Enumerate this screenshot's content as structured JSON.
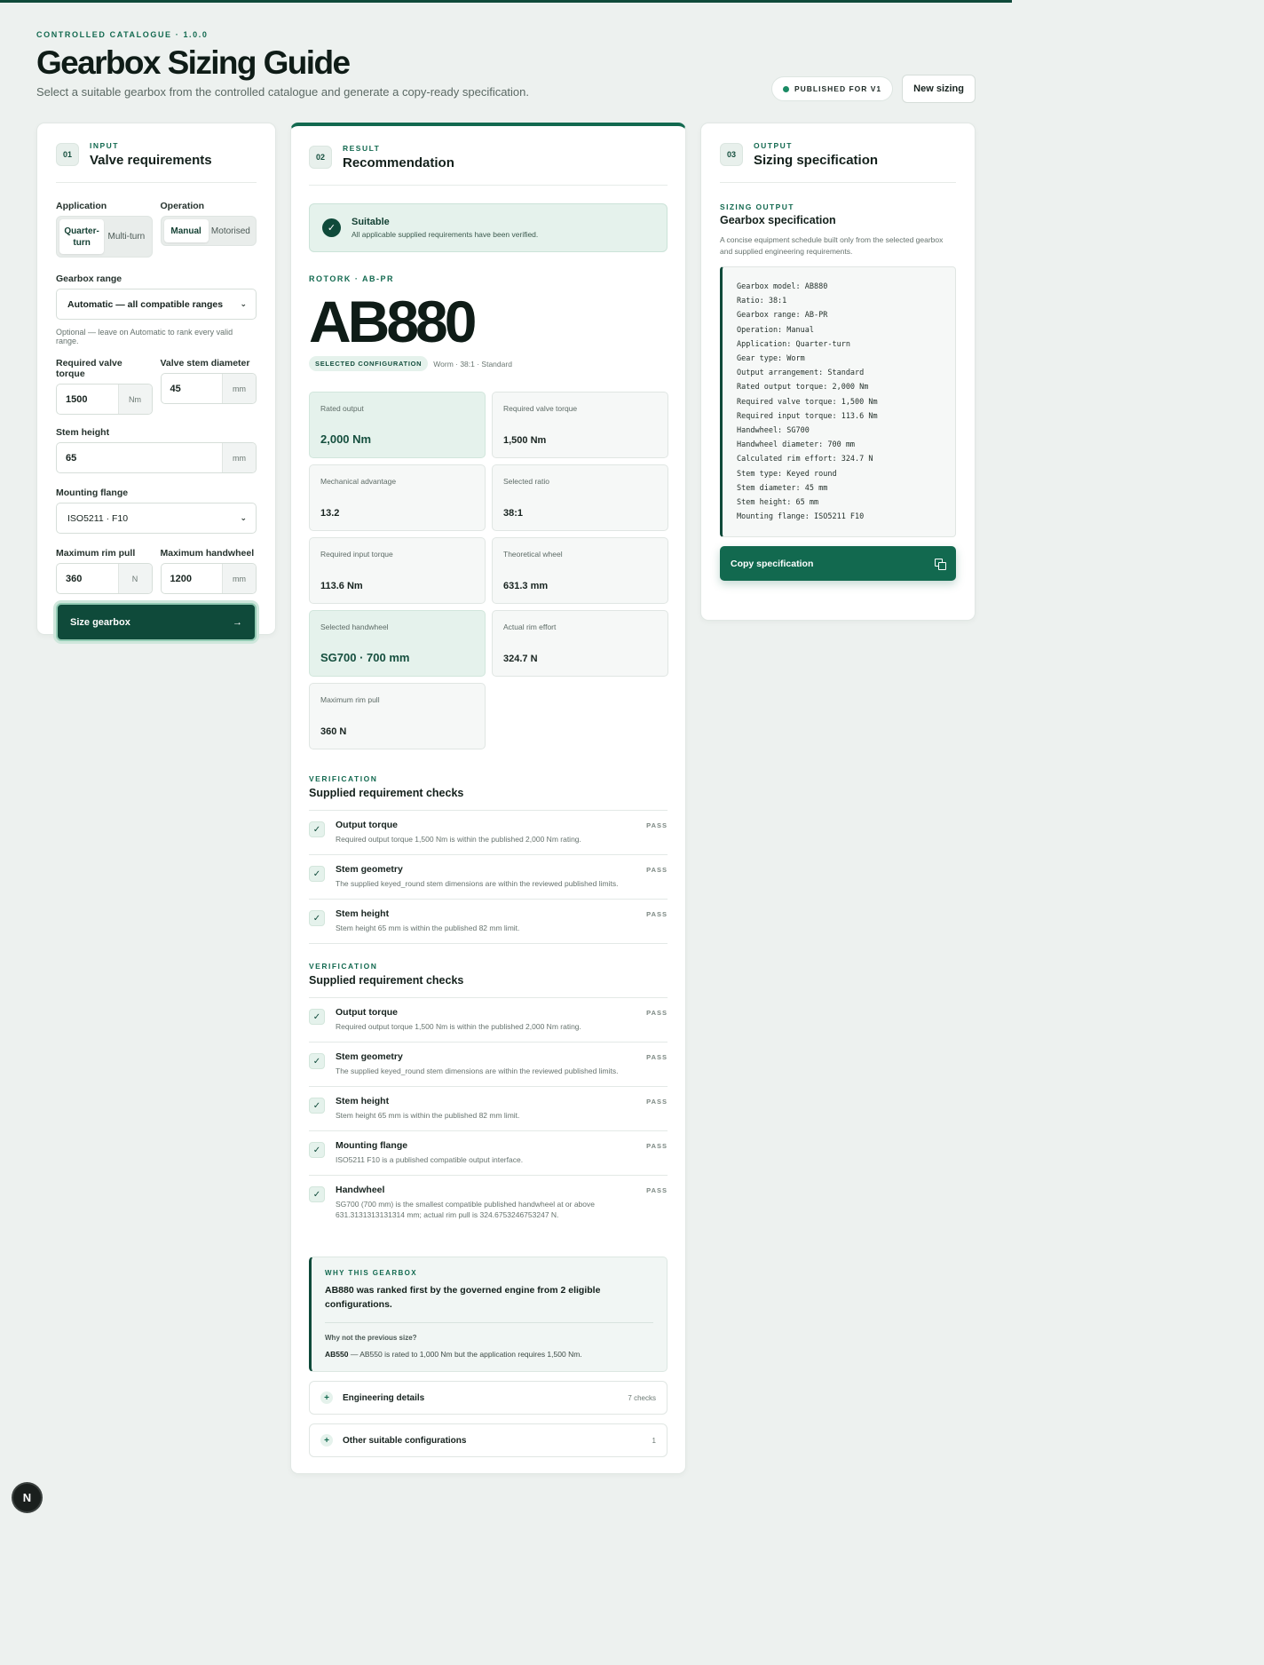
{
  "header": {
    "eyebrow": "CONTROLLED CATALOGUE · 1.0.0",
    "title": "Gearbox Sizing Guide",
    "subtitle": "Select a suitable gearbox from the controlled catalogue and generate a copy-ready specification.",
    "published_badge": "PUBLISHED FOR V1",
    "new_sizing_label": "New sizing"
  },
  "input": {
    "step": "01",
    "eyebrow": "INPUT",
    "title": "Valve requirements",
    "application_label": "Application",
    "application_options": [
      "Quarter-turn",
      "Multi-turn"
    ],
    "operation_label": "Operation",
    "operation_options": [
      "Manual",
      "Motorised"
    ],
    "gearbox_range_label": "Gearbox range",
    "gearbox_range_value": "Automatic — all compatible ranges",
    "gearbox_range_hint": "Optional — leave on Automatic to rank every valid range.",
    "torque_label": "Required valve torque",
    "torque_value": "1500",
    "torque_unit": "Nm",
    "stem_diameter_label": "Valve stem diameter",
    "stem_diameter_value": "45",
    "stem_diameter_unit": "mm",
    "stem_height_label": "Stem height",
    "stem_height_value": "65",
    "stem_height_unit": "mm",
    "flange_label": "Mounting flange",
    "flange_value": "ISO5211 · F10",
    "rim_pull_label": "Maximum rim pull",
    "rim_pull_value": "360",
    "rim_pull_unit": "N",
    "handwheel_label": "Maximum handwheel",
    "handwheel_value": "1200",
    "handwheel_unit": "mm",
    "size_button": "Size gearbox",
    "size_arrow": "→"
  },
  "result": {
    "step": "02",
    "eyebrow": "RESULT",
    "title": "Recommendation",
    "status_title": "Suitable",
    "status_sub": "All applicable supplied requirements have been verified.",
    "status_icon": "✓",
    "brand_line": "ROTORK · AB-PR",
    "model": "AB880",
    "config_badge": "SELECTED CONFIGURATION",
    "config_text": "Worm · 38:1 · Standard",
    "metrics": [
      {
        "label": "Rated output",
        "value": "2,000 Nm"
      },
      {
        "label": "Required valve torque",
        "value": "1,500 Nm"
      },
      {
        "label": "Mechanical advantage",
        "value": "13.2"
      },
      {
        "label": "Selected ratio",
        "value": "38:1"
      },
      {
        "label": "Required input torque",
        "value": "113.6 Nm"
      },
      {
        "label": "Theoretical wheel",
        "value": "631.3 mm"
      },
      {
        "label": "Selected handwheel",
        "value": "SG700 · 700 mm"
      },
      {
        "label": "Actual rim effort",
        "value": "324.7 N"
      },
      {
        "label": "Maximum rim pull",
        "value": "360 N"
      }
    ],
    "verification_1": {
      "eyebrow": "VERIFICATION",
      "title": "Supplied requirement checks",
      "checks": [
        {
          "title": "Output torque",
          "desc": "Required output torque 1,500 Nm is within the published 2,000 Nm rating.",
          "status": "PASS"
        },
        {
          "title": "Stem geometry",
          "desc": "The supplied keyed_round stem dimensions are within the reviewed published limits.",
          "status": "PASS"
        },
        {
          "title": "Stem height",
          "desc": "Stem height 65 mm is within the published 82 mm limit.",
          "status": "PASS"
        }
      ]
    },
    "verification_2": {
      "eyebrow": "VERIFICATION",
      "title": "Supplied requirement checks",
      "checks": [
        {
          "title": "Output torque",
          "desc": "Required output torque 1,500 Nm is within the published 2,000 Nm rating.",
          "status": "PASS"
        },
        {
          "title": "Stem geometry",
          "desc": "The supplied keyed_round stem dimensions are within the reviewed published limits.",
          "status": "PASS"
        },
        {
          "title": "Stem height",
          "desc": "Stem height 65 mm is within the published 82 mm limit.",
          "status": "PASS"
        },
        {
          "title": "Mounting flange",
          "desc": "ISO5211 F10 is a published compatible output interface.",
          "status": "PASS"
        },
        {
          "title": "Handwheel",
          "desc": "SG700 (700 mm) is the smallest compatible published handwheel at or above 631.3131313131314 mm; actual rim pull is 324.6753246753247 N.",
          "status": "PASS"
        }
      ]
    },
    "why": {
      "eyebrow": "WHY THIS GEARBOX",
      "text": "AB880 was ranked first by the governed engine from 2 eligible configurations.",
      "question": "Why not the previous size?",
      "answer_model": "AB550",
      "answer_text": " — AB550 is rated to 1,000 Nm but the application requires 1,500 Nm."
    },
    "engineering_label": "Engineering details",
    "engineering_count": "7 checks",
    "other_label": "Other suitable configurations",
    "other_count": "1"
  },
  "output": {
    "step": "03",
    "eyebrow": "OUTPUT",
    "title": "Sizing specification",
    "sub_eyebrow": "SIZING OUTPUT",
    "sub_title": "Gearbox specification",
    "desc": "A concise equipment schedule built only from the selected gearbox and supplied engineering requirements.",
    "spec_lines": [
      "Gearbox model: AB880",
      "Ratio: 38:1",
      "Gearbox range: AB-PR",
      "Operation: Manual",
      "Application: Quarter-turn",
      "Gear type: Worm",
      "Output arrangement: Standard",
      "Rated output torque: 2,000 Nm",
      "Required valve torque: 1,500 Nm",
      "Required input torque: 113.6 Nm",
      "Handwheel: SG700",
      "Handwheel diameter: 700 mm",
      "Calculated rim effort: 324.7 N",
      "Stem type: Keyed round",
      "Stem diameter: 45 mm",
      "Stem height: 65 mm",
      "Mounting flange: ISO5211 F10"
    ],
    "copy_button": "Copy specification"
  },
  "fab_label": "N",
  "colors": {
    "accent": "#12694f",
    "dark_accent": "#0f4a3a",
    "background": "#edf1ef"
  }
}
